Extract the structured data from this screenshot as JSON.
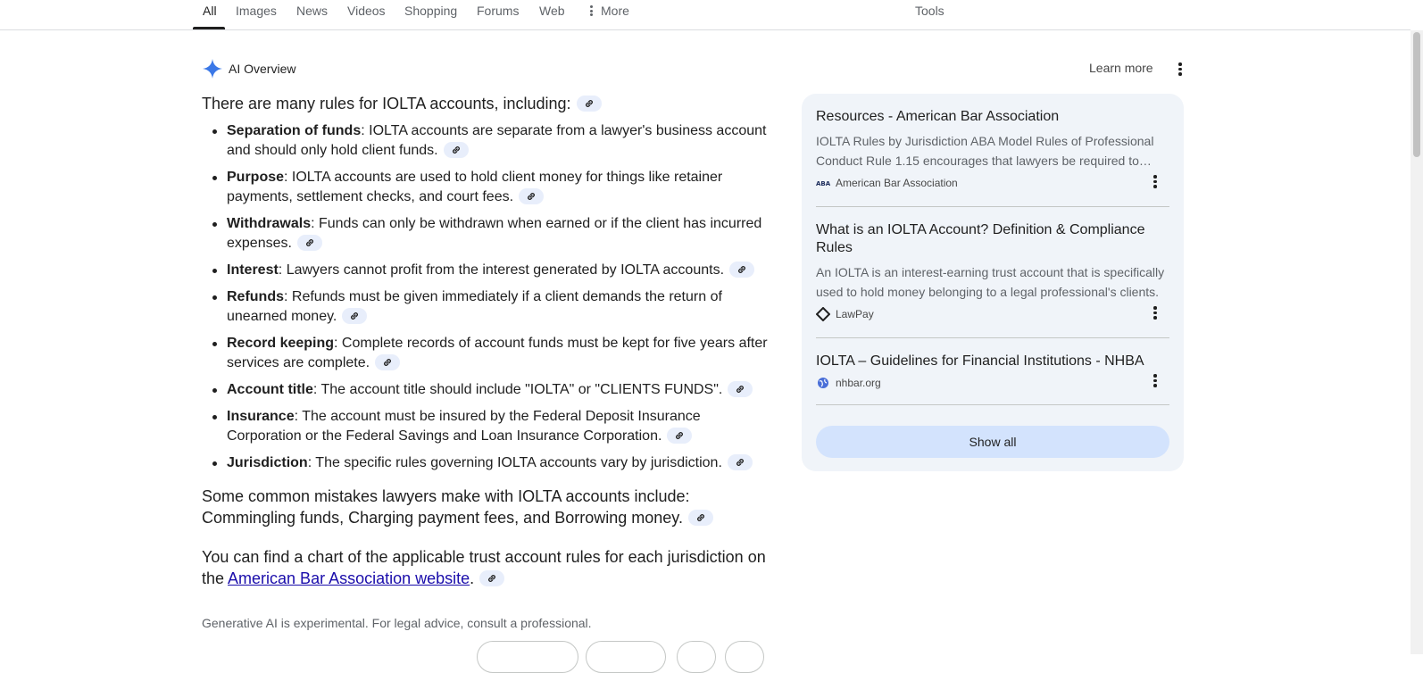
{
  "nav": {
    "tabs": [
      "All",
      "Images",
      "News",
      "Videos",
      "Shopping",
      "Forums",
      "Web",
      "More"
    ],
    "tools": "Tools"
  },
  "ai": {
    "title": "AI Overview",
    "learn_more": "Learn more",
    "intro": "There are many rules for IOLTA accounts, including:",
    "bullets": [
      {
        "term": "Separation of funds",
        "text": ": IOLTA accounts are separate from a lawyer's business account and should only hold client funds."
      },
      {
        "term": "Purpose",
        "text": ": IOLTA accounts are used to hold client money for things like retainer payments, settlement checks, and court fees."
      },
      {
        "term": "Withdrawals",
        "text": ": Funds can only be withdrawn when earned or if the client has incurred expenses."
      },
      {
        "term": "Interest",
        "text": ": Lawyers cannot profit from the interest generated by IOLTA accounts."
      },
      {
        "term": "Refunds",
        "text": ": Refunds must be given immediately if a client demands the return of unearned money."
      },
      {
        "term": "Record keeping",
        "text": ": Complete records of account funds must be kept for five years after services are complete."
      },
      {
        "term": "Account title",
        "text": ": The account title should include \"IOLTA\" or \"CLIENTS FUNDS\"."
      },
      {
        "term": "Insurance",
        "text": ": The account must be insured by the Federal Deposit Insurance Corporation or the Federal Savings and Loan Insurance Corporation."
      },
      {
        "term": "Jurisdiction",
        "text": ": The specific rules governing IOLTA accounts vary by jurisdiction."
      }
    ],
    "mistakes": "Some common mistakes lawyers make with IOLTA accounts include: Commingling funds, Charging payment fees, and Borrowing money.",
    "chart_pre": "You can find a chart of the applicable trust account rules for each jurisdiction on the ",
    "chart_link": "American Bar Association website",
    "chart_post": ".",
    "disclaimer": "Generative AI is experimental. For legal advice, consult a professional."
  },
  "sources": [
    {
      "title": "Resources - American Bar Association",
      "snippet": "IOLTA Rules by Jurisdiction ABA Model Rules of Professional Conduct Rule 1.15 encourages that lawyers be required to maintain...",
      "site": "American Bar Association",
      "icon": "aba-logo-icon"
    },
    {
      "title": "What is an IOLTA Account? Definition & Compliance Rules",
      "snippet": "An IOLTA is an interest-earning trust account that is specifically used to hold money belonging to a legal professional's clients.",
      "site": "LawPay",
      "icon": "lawpay-logo-icon"
    },
    {
      "title": "IOLTA – Guidelines for Financial Institutions - NHBA",
      "snippet": "",
      "site": "nhbar.org",
      "icon": "globe-icon"
    }
  ],
  "show_all": "Show all"
}
